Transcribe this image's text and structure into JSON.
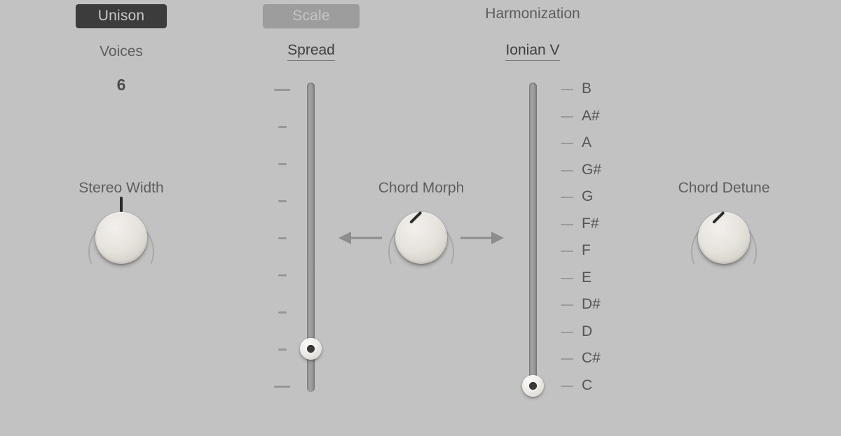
{
  "panel": {
    "background_color": "#c2c2c2",
    "text_color": "#5e5e5e"
  },
  "tabs": [
    {
      "label": "Unison",
      "state": "active",
      "bg": "#3c3c3c",
      "fg": "#c8c8c8"
    },
    {
      "label": "Scale",
      "state": "inactive",
      "bg": "#9d9d9d",
      "fg": "#c5c5c5"
    }
  ],
  "header": {
    "harmonization_label": "Harmonization"
  },
  "unison": {
    "voices_label": "Voices",
    "voices_value": "6",
    "stereo_width_label": "Stereo Width",
    "stereo_width_angle_deg": 0
  },
  "spread": {
    "param_label": "Spread",
    "tick_count": 9,
    "thumb_position_index": 7
  },
  "chord_morph": {
    "label": "Chord Morph",
    "left_arrow_icon": "arrow-left-icon",
    "right_arrow_icon": "arrow-right-icon",
    "angle_deg": -135
  },
  "harmonization": {
    "param_label": "Ionian V",
    "notes": [
      "B",
      "A#",
      "A",
      "G#",
      "G",
      "F#",
      "F",
      "E",
      "D#",
      "D",
      "C#",
      "C"
    ],
    "selected_note": "C",
    "thumb_position_index": 11
  },
  "chord_detune": {
    "label": "Chord Detune",
    "angle_deg": -135
  }
}
